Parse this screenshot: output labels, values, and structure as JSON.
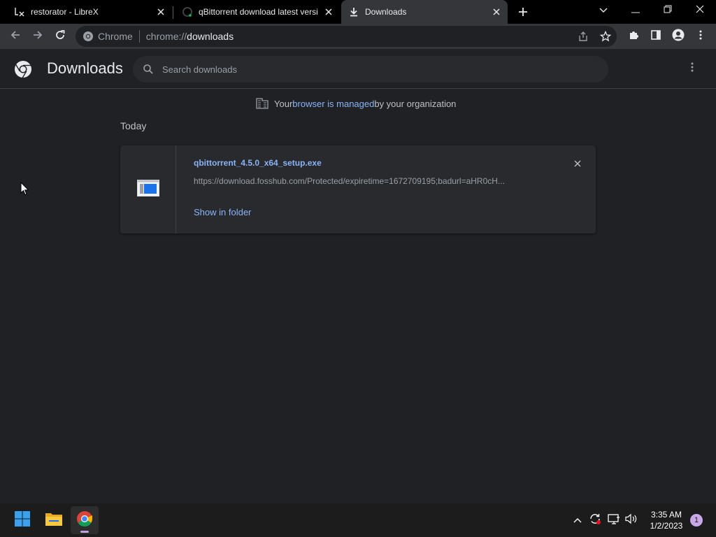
{
  "tabs": [
    {
      "title": "restorator - LibreX",
      "icon": "librex-icon",
      "active": false
    },
    {
      "title": "qBittorrent download latest versi",
      "icon": "loading-icon",
      "active": false
    },
    {
      "title": "Downloads",
      "icon": "download-icon",
      "active": true
    }
  ],
  "omnibox": {
    "scheme_label": "Chrome",
    "url_prefix": "chrome://",
    "url_host": "downloads"
  },
  "page": {
    "title": "Downloads",
    "search_placeholder": "Search downloads",
    "managed_prefix": "Your ",
    "managed_link": "browser is managed",
    "managed_suffix": " by your organization",
    "section_date": "Today"
  },
  "download": {
    "filename": "qbittorrent_4.5.0_x64_setup.exe",
    "url": "https://download.fosshub.com/Protected/expiretime=1672709195;badurl=aHR0cH...",
    "action": "Show in folder"
  },
  "taskbar": {
    "time": "3:35 AM",
    "date": "1/2/2023",
    "notification_count": "1"
  },
  "colors": {
    "accent_link": "#8ab4f8",
    "background": "#202124",
    "toolbar": "#35363a"
  }
}
